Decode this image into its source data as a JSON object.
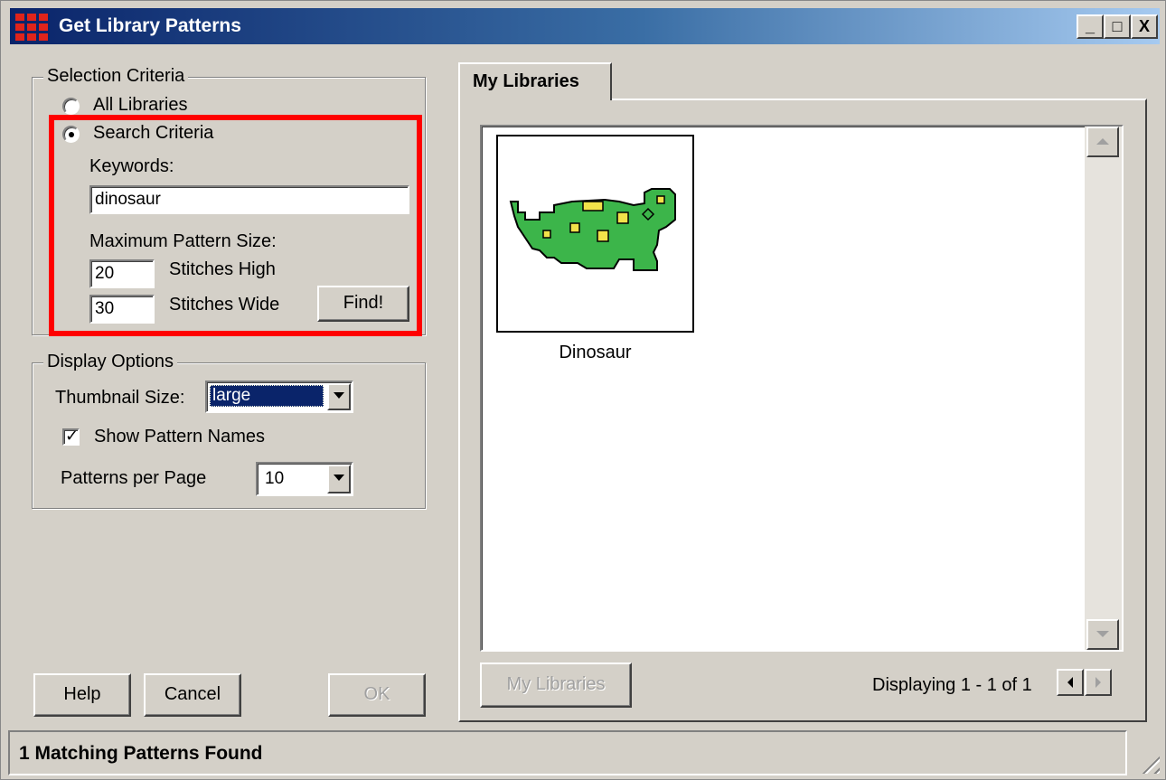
{
  "window": {
    "title": "Get Library Patterns",
    "controls": {
      "minimize": "_",
      "maximize": "□",
      "close": "X"
    }
  },
  "selection_criteria": {
    "legend": "Selection Criteria",
    "all_libraries_label": "All Libraries",
    "search_criteria_label": "Search Criteria",
    "selected_option": "Search Criteria",
    "keywords_label": "Keywords:",
    "keywords_value": "dinosaur",
    "max_size_label": "Maximum Pattern Size:",
    "stitches_high_value": "20",
    "stitches_high_label": "Stitches High",
    "stitches_wide_value": "30",
    "stitches_wide_label": "Stitches Wide",
    "find_button": "Find!"
  },
  "display_options": {
    "legend": "Display Options",
    "thumbnail_size_label": "Thumbnail Size:",
    "thumbnail_size_value": "large",
    "show_names_label": "Show Pattern Names",
    "show_names_checked": true,
    "patterns_per_page_label": "Patterns per Page",
    "patterns_per_page_value": "10"
  },
  "footer_buttons": {
    "help": "Help",
    "cancel": "Cancel",
    "ok": "OK"
  },
  "tabs": [
    {
      "label": "My Libraries",
      "active": true
    }
  ],
  "results": {
    "items": [
      {
        "name": "Dinosaur",
        "thumbnail": "dinosaur-pattern"
      }
    ],
    "my_libraries_button": "My Libraries",
    "paging_text": "Displaying 1 - 1 of 1"
  },
  "status": {
    "text": "1 Matching Patterns Found"
  },
  "colors": {
    "titlebar_start": "#0a246a",
    "titlebar_end": "#a6caf0",
    "highlight_frame": "#ff0000",
    "dino_green": "#3cb54a",
    "dino_spots": "#f2e24a"
  }
}
